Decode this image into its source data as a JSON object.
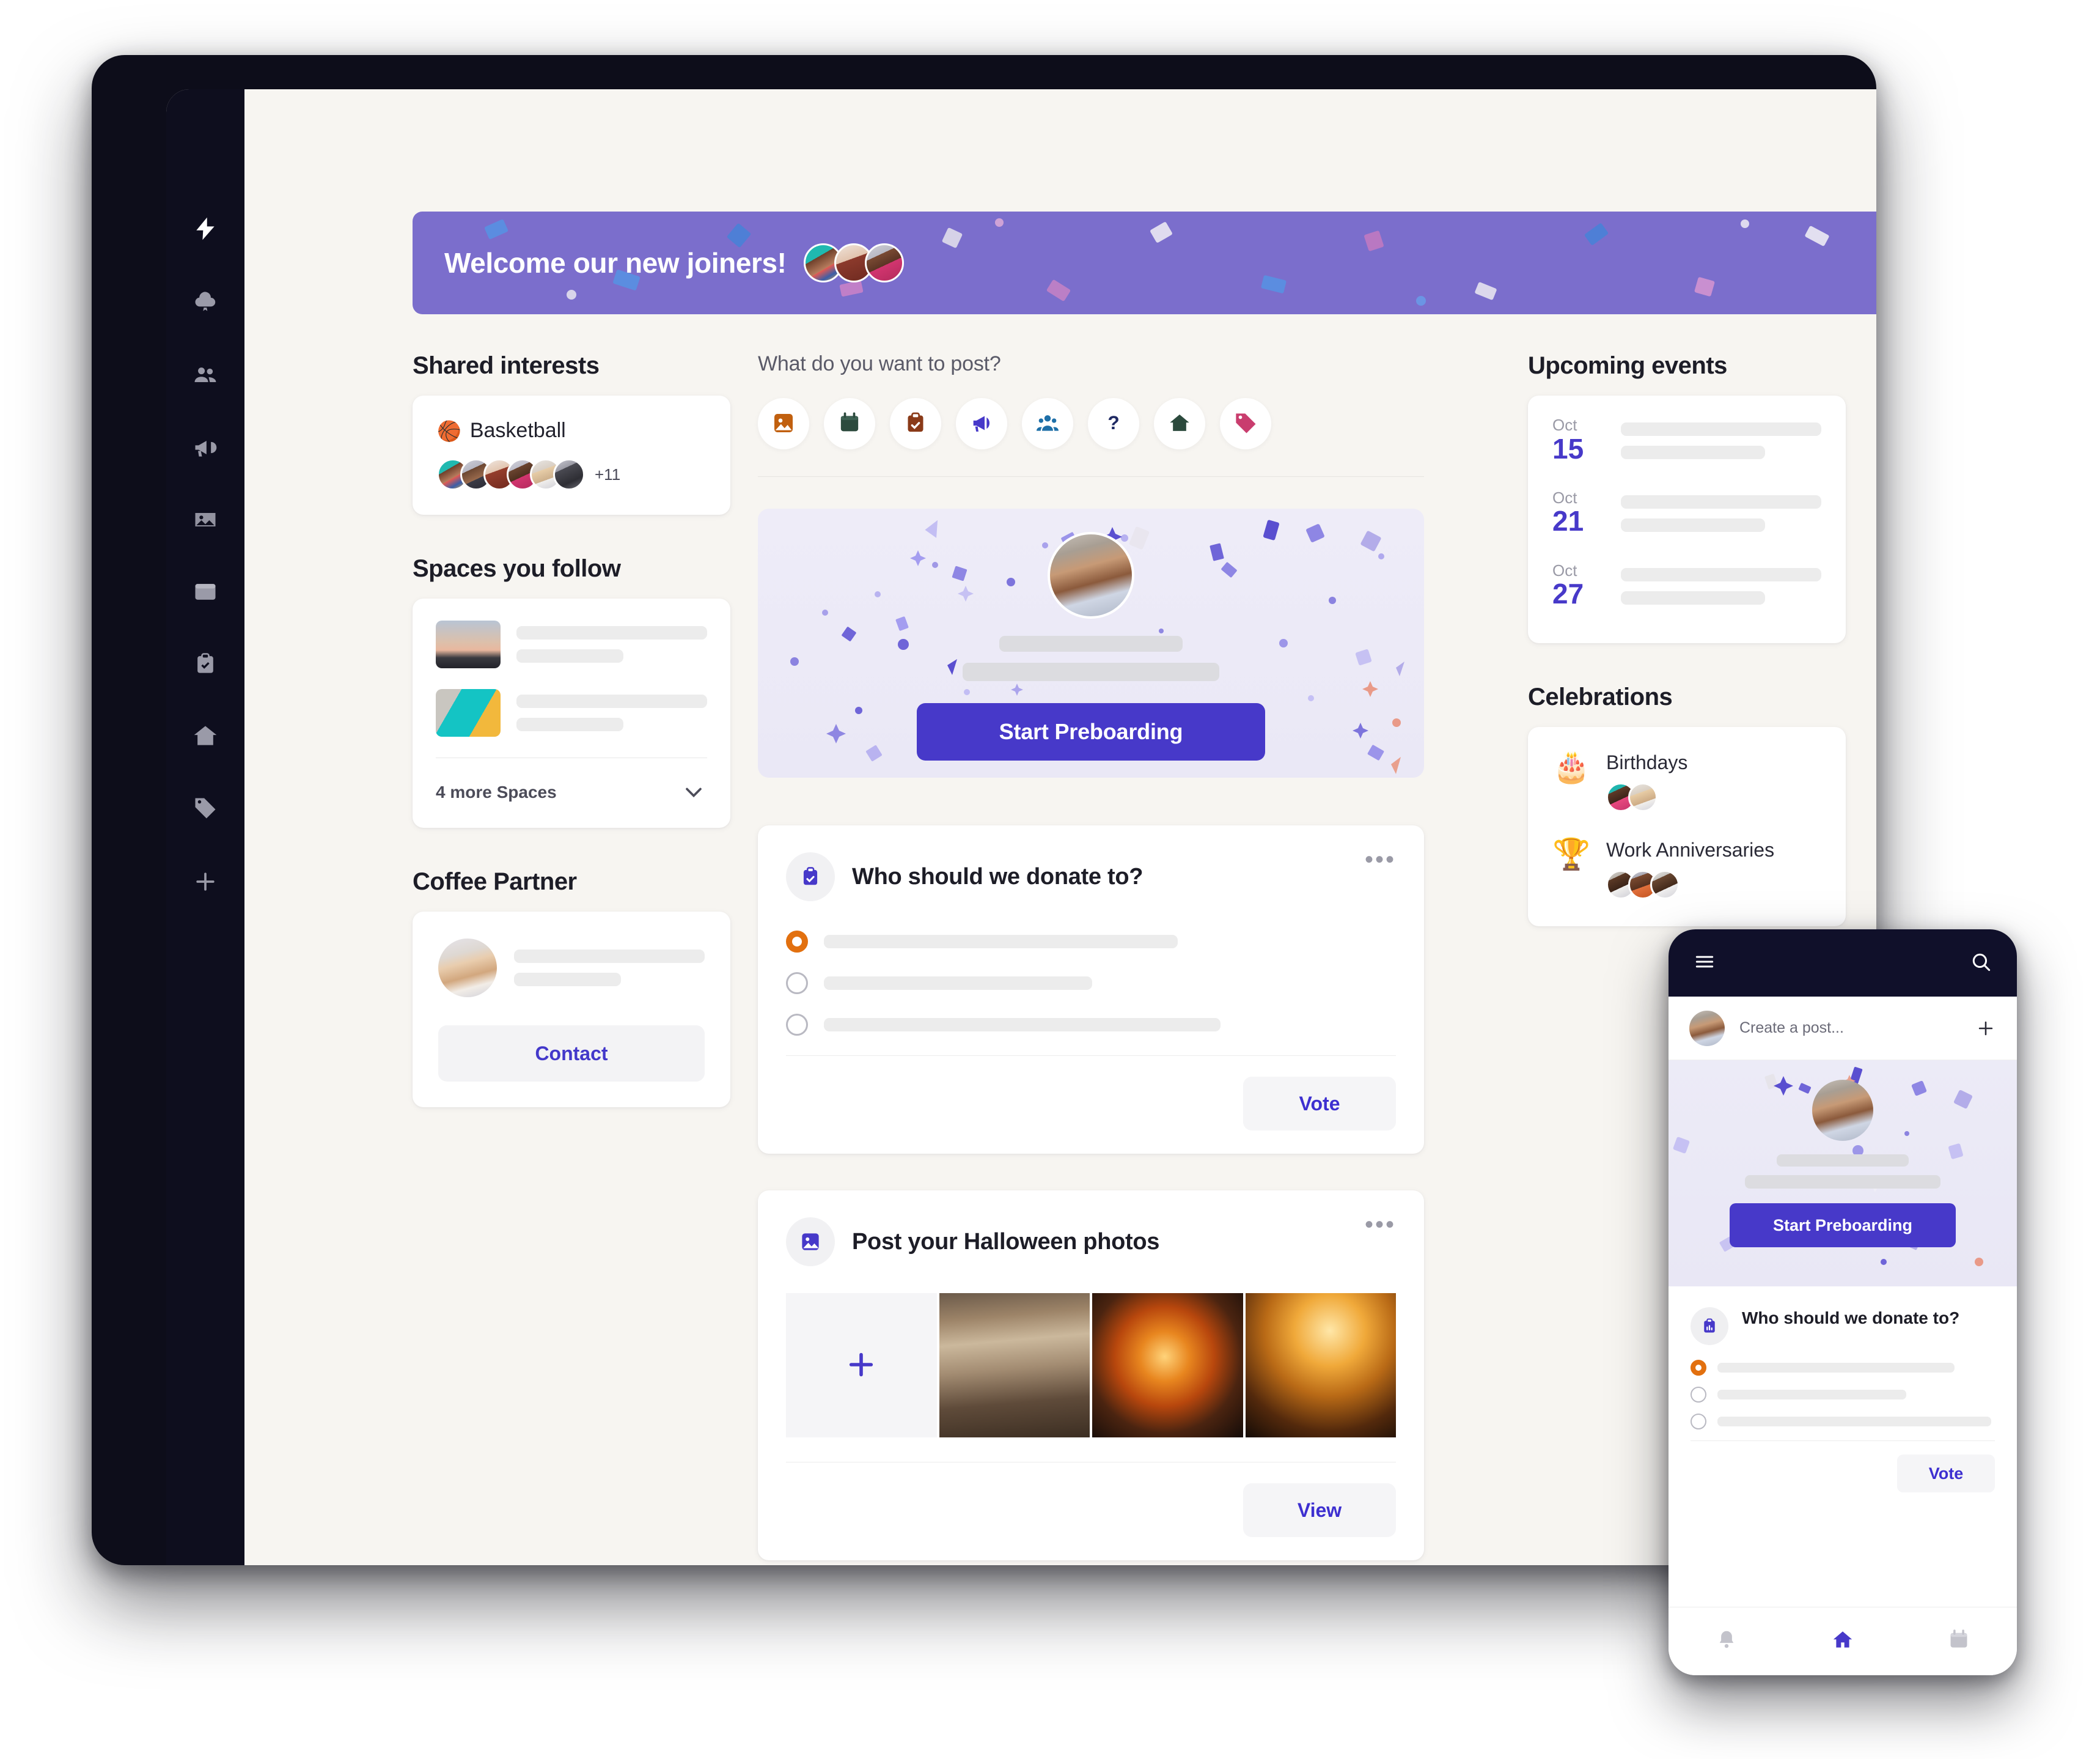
{
  "sidebar": {
    "items": [
      {
        "icon": "lightning-icon",
        "active": true
      },
      {
        "icon": "cloud-badge-icon",
        "active": false
      },
      {
        "icon": "people-icon",
        "active": false
      },
      {
        "icon": "megaphone-icon",
        "active": false
      },
      {
        "icon": "image-icon",
        "active": false
      },
      {
        "icon": "calendar-icon",
        "active": false
      },
      {
        "icon": "clipboard-icon",
        "active": false
      },
      {
        "icon": "house-icon",
        "active": false
      },
      {
        "icon": "tag-icon",
        "active": false
      },
      {
        "icon": "plus-icon",
        "active": false
      }
    ]
  },
  "banner": {
    "title": "Welcome our new joiners!",
    "color": "#7b6ecc",
    "avatar_count": 3
  },
  "shared_interests": {
    "title": "Shared interests",
    "interest": {
      "emoji": "🏀",
      "name": "Basketball",
      "avatar_count": 6,
      "more_count": "+11"
    }
  },
  "spaces": {
    "title": "Spaces you follow",
    "rows": 2,
    "more_label": "4 more Spaces",
    "chevron": "chevron-down-icon"
  },
  "coffee_partner": {
    "title": "Coffee Partner",
    "contact_label": "Contact",
    "contact_color": "#4338ca"
  },
  "composer": {
    "prompt": "What do you want to post?",
    "buttons": [
      {
        "icon": "image-icon",
        "color": "#c1600f"
      },
      {
        "icon": "calendar-icon",
        "color": "#2c4a3d"
      },
      {
        "icon": "clipboard-check-icon",
        "color": "#8a3a18"
      },
      {
        "icon": "megaphone-icon",
        "color": "#4739c9"
      },
      {
        "icon": "people-group-icon",
        "color": "#1e6fa8"
      },
      {
        "icon": "question-mark-icon",
        "color": "#1f2a63"
      },
      {
        "icon": "house-icon",
        "color": "#2c4a3d"
      },
      {
        "icon": "tag-icon",
        "color": "#c93d6e"
      }
    ]
  },
  "preboarding": {
    "button_label": "Start Preboarding",
    "button_color": "#4739c9"
  },
  "poll_post": {
    "icon": "poll-clipboard-icon",
    "title": "Who should we donate to?",
    "more_label": "•••",
    "options": [
      {
        "selected": true,
        "bar_width": "58%"
      },
      {
        "selected": false,
        "bar_width": "44%"
      },
      {
        "selected": false,
        "bar_width": "65%"
      }
    ],
    "action_label": "Vote"
  },
  "photo_post": {
    "icon": "image-icon",
    "title": "Post your Halloween photos",
    "more_label": "•••",
    "add_label": "plus-icon",
    "photo_count": 3,
    "action_label": "View"
  },
  "upcoming_events": {
    "title": "Upcoming events",
    "events": [
      {
        "month": "Oct",
        "day": "15"
      },
      {
        "month": "Oct",
        "day": "21"
      },
      {
        "month": "Oct",
        "day": "27"
      }
    ]
  },
  "celebrations": {
    "title": "Celebrations",
    "items": [
      {
        "emoji": "🎂",
        "label": "Birthdays",
        "avatar_count": 2
      },
      {
        "emoji": "🏆",
        "label": "Work Anniversaries",
        "avatar_count": 3
      }
    ]
  },
  "phone": {
    "menu_icon": "hamburger-menu-icon",
    "search_icon": "search-icon",
    "composer_placeholder": "Create a post...",
    "plus_icon": "plus-icon",
    "preboarding_button": "Start Preboarding",
    "poll_title": "Who should we donate to?",
    "poll_options": [
      {
        "selected": true,
        "bar_width": "78%"
      },
      {
        "selected": false,
        "bar_width": "62%"
      },
      {
        "selected": false,
        "bar_width": "90%"
      }
    ],
    "vote_label": "Vote",
    "nav": [
      {
        "icon": "bell-icon",
        "active": false
      },
      {
        "icon": "home-icon",
        "active": true
      },
      {
        "icon": "calendar-icon",
        "active": false
      }
    ]
  }
}
